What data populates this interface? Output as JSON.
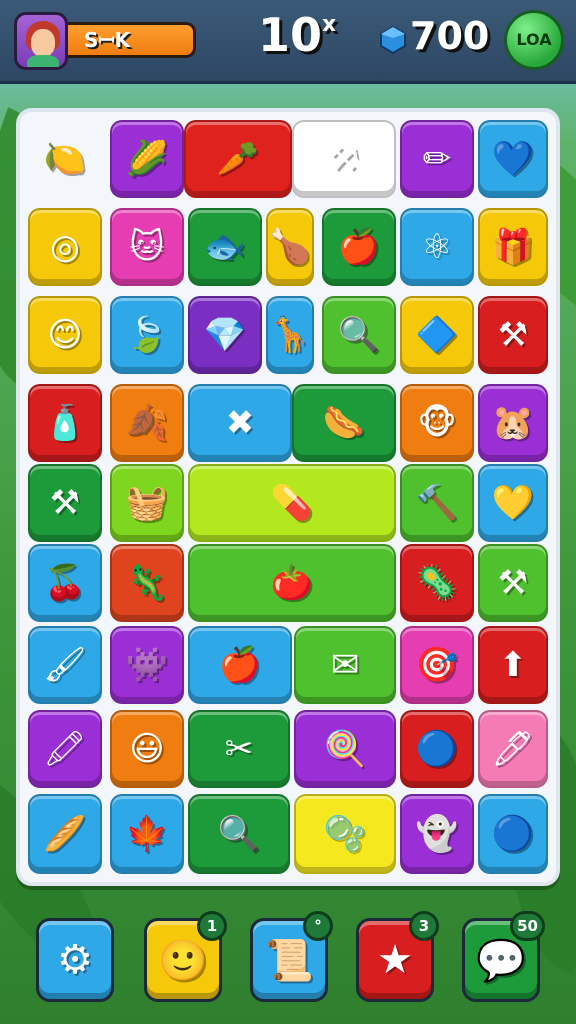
{
  "header": {
    "player_name": "SꟷK",
    "level": "10",
    "level_mark": "x",
    "gems": "700",
    "level_button": "LOA",
    "colors": {
      "bar": "#2d4763",
      "name_bg": "#f07d10",
      "level_button": "#28a83a",
      "gem": "#2b8fe0"
    }
  },
  "board": {
    "tiles": [
      {
        "color": "#ffffff",
        "icon": "lemon-icon",
        "glyph": "🍋",
        "plain": true
      },
      {
        "color": "#9b2fd6",
        "icon": "corn-icon",
        "glyph": "🌽"
      },
      {
        "color": "#e0221f",
        "icon": "carrot-icon",
        "glyph": "🥕"
      },
      {
        "color": "#ffffff",
        "icon": "crossed-tools-icon",
        "glyph": "⚒"
      },
      {
        "color": "#9b2fd6",
        "icon": "pencil-icon",
        "glyph": "✏"
      },
      {
        "color": "#2fa8e8",
        "icon": "heart-balloon-icon",
        "glyph": "💙"
      },
      {
        "color": "#f5c90a",
        "icon": "ring-icon",
        "glyph": "◎"
      },
      {
        "color": "#e63db3",
        "icon": "cat-face-icon",
        "glyph": "🐱"
      },
      {
        "color": "#1d9b3a",
        "icon": "fish-icon",
        "glyph": "🐟"
      },
      {
        "color": "#f5c90a",
        "icon": "drumstick-icon",
        "glyph": "🍗"
      },
      {
        "color": "#1d9b3a",
        "icon": "apple-icon",
        "glyph": "🍎"
      },
      {
        "color": "#2fa8e8",
        "icon": "molecule-icon",
        "glyph": "⚛"
      },
      {
        "color": "#f5c90a",
        "icon": "gift-box-icon",
        "glyph": "🎁"
      },
      {
        "color": "#f5c90a",
        "icon": "smiley-icon",
        "glyph": "😊"
      },
      {
        "color": "#2fa8e8",
        "icon": "leaf-icon",
        "glyph": "🍃"
      },
      {
        "color": "#7a2fc2",
        "icon": "crystal-icon",
        "glyph": "💎"
      },
      {
        "color": "#2fa8e8",
        "icon": "giraffe-icon",
        "glyph": "🦒"
      },
      {
        "color": "#4fc12e",
        "icon": "magnifier-icon",
        "glyph": "🔍"
      },
      {
        "color": "#f5c90a",
        "icon": "blue-gem-icon",
        "glyph": "🔷"
      },
      {
        "color": "#d81e1e",
        "icon": "crossed-hammers-icon",
        "glyph": "⚒"
      },
      {
        "color": "#d81e1e",
        "icon": "bottle-icon",
        "glyph": "🧴"
      },
      {
        "color": "#f07d10",
        "icon": "leaf-ball-icon",
        "glyph": "🍂"
      },
      {
        "color": "#2fa8e8",
        "icon": "bandage-icon",
        "glyph": "✖"
      },
      {
        "color": "#1d9b3a",
        "icon": "sausage-icon",
        "glyph": "🌭"
      },
      {
        "color": "#f07d10",
        "icon": "monkey-face-icon",
        "glyph": "🐵"
      },
      {
        "color": "#9b2fd6",
        "icon": "hamster-icon",
        "glyph": "🐹"
      },
      {
        "color": "#1d9b3a",
        "icon": "crossed-wrenches-icon",
        "glyph": "⚒"
      },
      {
        "color": "#7fd61f",
        "icon": "basket-icon",
        "glyph": "🧺"
      },
      {
        "color": "#b3e81f",
        "icon": "red-capsule-icon",
        "glyph": "💊"
      },
      {
        "color": "#4fc12e",
        "icon": "hammer-icon",
        "glyph": "🔨"
      },
      {
        "color": "#2fa8e8",
        "icon": "yellow-heart-icon",
        "glyph": "💛"
      },
      {
        "color": "#2fa8e8",
        "icon": "cherry-icon",
        "glyph": "🍒"
      },
      {
        "color": "#e0441f",
        "icon": "lizard-icon",
        "glyph": "🦎"
      },
      {
        "color": "#4fc12e",
        "icon": "tomato-icon",
        "glyph": "🍅"
      },
      {
        "color": "#d81e1e",
        "icon": "virus-icon",
        "glyph": "🦠"
      },
      {
        "color": "#4fc12e",
        "icon": "crossed-tools-icon",
        "glyph": "⚒"
      },
      {
        "color": "#2fa8e8",
        "icon": "paintbrush-icon",
        "glyph": "🖌"
      },
      {
        "color": "#9b2fd6",
        "icon": "alien-face-icon",
        "glyph": "👾"
      },
      {
        "color": "#2fa8e8",
        "icon": "red-apple-icon",
        "glyph": "🍎"
      },
      {
        "color": "#4fc12e",
        "icon": "envelope-icon",
        "glyph": "✉"
      },
      {
        "color": "#e63db3",
        "icon": "target-icon",
        "glyph": "🎯"
      },
      {
        "color": "#d81e1e",
        "icon": "up-arrow-icon",
        "glyph": "⬆"
      },
      {
        "color": "#9b2fd6",
        "icon": "brush-icon",
        "glyph": "🖍"
      },
      {
        "color": "#f07d10",
        "icon": "orange-smiley-icon",
        "glyph": "😃"
      },
      {
        "color": "#1d9b3a",
        "icon": "scissors-icon",
        "glyph": "✂"
      },
      {
        "color": "#9b2fd6",
        "icon": "lollipop-icon",
        "glyph": "🍭"
      },
      {
        "color": "#d81e1e",
        "icon": "blue-ball-icon",
        "glyph": "🔵"
      },
      {
        "color": "#f57bb5",
        "icon": "green-marker-icon",
        "glyph": "🖊"
      },
      {
        "color": "#2fa8e8",
        "icon": "bread-icon",
        "glyph": "🥖"
      },
      {
        "color": "#2fa8e8",
        "icon": "feather-leaf-icon",
        "glyph": "🍁"
      },
      {
        "color": "#1d9b3a",
        "icon": "search-ring-icon",
        "glyph": "🔍"
      },
      {
        "color": "#f5e81f",
        "icon": "bubble-icon",
        "glyph": "🫧"
      },
      {
        "color": "#9b2fd6",
        "icon": "ghost-icon",
        "glyph": "👻"
      },
      {
        "color": "#2fa8e8",
        "icon": "marble-icon",
        "glyph": "🔵"
      }
    ]
  },
  "toolbar": {
    "items": [
      {
        "name": "settings",
        "icon": "gear-icon",
        "glyph": "⚙",
        "color": "#2fa8e8",
        "badge": ""
      },
      {
        "name": "character",
        "icon": "character-face-icon",
        "glyph": "🙂",
        "color": "#f5c90a",
        "badge": "1"
      },
      {
        "name": "scroll",
        "icon": "scroll-icon",
        "glyph": "📜",
        "color": "#2fa8e8",
        "badge": "°"
      },
      {
        "name": "star",
        "icon": "star-icon",
        "glyph": "★",
        "color": "#d81e1e",
        "badge": "3"
      },
      {
        "name": "chat",
        "icon": "chat-bubble-icon",
        "glyph": "💬",
        "color": "#1d9b3a",
        "badge": "50"
      }
    ]
  }
}
